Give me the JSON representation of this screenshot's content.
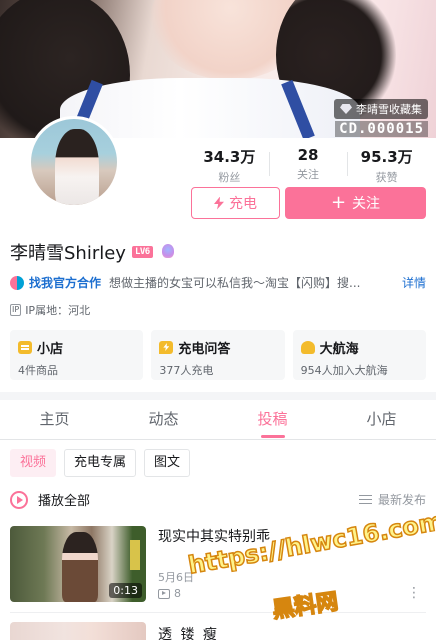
{
  "banner": {
    "collection_label": "李晴雪收藏集",
    "collection_code": "CD.000015"
  },
  "stats": [
    {
      "value": "34.3万",
      "label": "粉丝"
    },
    {
      "value": "28",
      "label": "关注"
    },
    {
      "value": "95.3万",
      "label": "获赞"
    }
  ],
  "actions": {
    "charge_label": "充电",
    "follow_label": "关注"
  },
  "profile": {
    "name": "李晴雪Shirley",
    "level": "LV6"
  },
  "business": {
    "link_label": "找我官方合作",
    "text": "想做主播的女宝可以私信我～淘宝【闪购】搜...",
    "more_label": "详情"
  },
  "ip": {
    "icon_text": "IP",
    "label": "IP属地：河北"
  },
  "cards": [
    {
      "title": "小店",
      "sub": "4件商品"
    },
    {
      "title": "充电问答",
      "sub": "377人充电"
    },
    {
      "title": "大航海",
      "sub": "954人加入大航海"
    }
  ],
  "tabs": [
    "主页",
    "动态",
    "投稿",
    "小店"
  ],
  "chips": [
    "视频",
    "充电专属",
    "图文"
  ],
  "play_all": {
    "label": "播放全部",
    "sort_label": "最新发布"
  },
  "videos": [
    {
      "title": "现实中其实特别乖",
      "duration": "0:13",
      "date": "5月6日",
      "plays": "8"
    },
    {
      "title": "透 镂 瘦"
    }
  ],
  "watermark": {
    "url": "https://hlwc16.com",
    "sub": "黑料网"
  },
  "colors": {
    "accent": "#fb7299",
    "link": "#1d6fd0"
  }
}
